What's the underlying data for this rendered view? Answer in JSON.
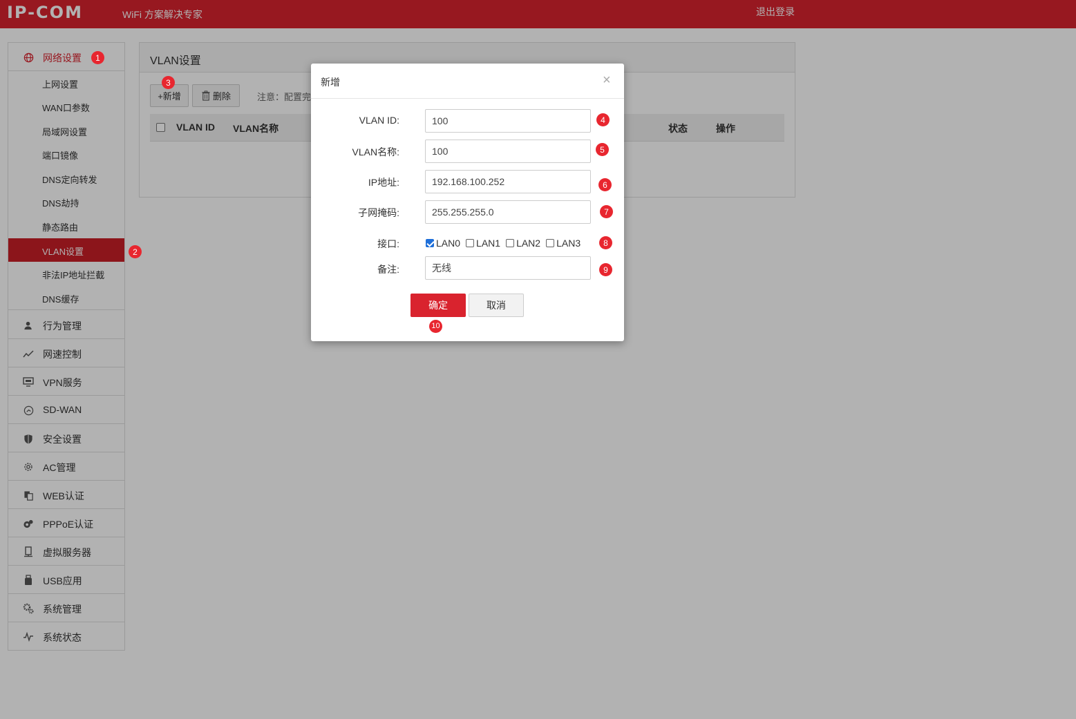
{
  "header": {
    "logo": "IP-COM",
    "tagline": "WiFi 方案解决专家",
    "logout": "退出登录"
  },
  "sidebar": {
    "groups": [
      {
        "label": "网络设置",
        "icon": "globe-icon"
      },
      {
        "label": "行为管理",
        "icon": "user-icon"
      },
      {
        "label": "网速控制",
        "icon": "chart-line-icon"
      },
      {
        "label": "VPN服务",
        "icon": "monitor-icon"
      },
      {
        "label": "SD-WAN",
        "icon": "compass-icon"
      },
      {
        "label": "安全设置",
        "icon": "shield-icon"
      },
      {
        "label": "AC管理",
        "icon": "gear-outline-icon"
      },
      {
        "label": "WEB认证",
        "icon": "copy-icon"
      },
      {
        "label": "PPPoE认证",
        "icon": "network-icon"
      },
      {
        "label": "虚拟服务器",
        "icon": "server-icon"
      },
      {
        "label": "USB应用",
        "icon": "usb-icon"
      },
      {
        "label": "系统管理",
        "icon": "gears-icon"
      },
      {
        "label": "系统状态",
        "icon": "pulse-icon"
      }
    ],
    "subitems": [
      {
        "label": "上网设置"
      },
      {
        "label": "WAN口参数"
      },
      {
        "label": "局域网设置"
      },
      {
        "label": "端口镜像"
      },
      {
        "label": "DNS定向转发"
      },
      {
        "label": "DNS劫持"
      },
      {
        "label": "静态路由"
      },
      {
        "label": "VLAN设置"
      },
      {
        "label": "非法IP地址拦截"
      },
      {
        "label": "DNS缓存"
      }
    ]
  },
  "panel": {
    "title": "VLAN设置",
    "add_label": "+新增",
    "delete_label": "删除",
    "note": "注意：配置完",
    "columns": {
      "vlan_id": "VLAN ID",
      "vlan_name": "VLAN名称",
      "status": "状态",
      "action": "操作"
    }
  },
  "modal": {
    "title": "新增",
    "close": "×",
    "fields": {
      "vlan_id": {
        "label": "VLAN ID:",
        "value": "100"
      },
      "vlan_name": {
        "label": "VLAN名称:",
        "value": "100"
      },
      "ip": {
        "label": "IP地址:",
        "value": "192.168.100.252"
      },
      "mask": {
        "label": "子网掩码:",
        "value": "255.255.255.0"
      },
      "ports_label": "接口:",
      "remark": {
        "label": "备注:",
        "value": "无线"
      }
    },
    "ports": [
      {
        "name": "LAN0",
        "checked": true
      },
      {
        "name": "LAN1",
        "checked": false
      },
      {
        "name": "LAN2",
        "checked": false
      },
      {
        "name": "LAN3",
        "checked": false
      }
    ],
    "ok_label": "确定",
    "cancel_label": "取消"
  },
  "markers": [
    "1",
    "2",
    "3",
    "4",
    "5",
    "6",
    "7",
    "8",
    "9",
    "10"
  ],
  "colors": {
    "brand": "#d9232e",
    "marker": "#e8262f",
    "checkbox_on": "#1e6fd9"
  }
}
